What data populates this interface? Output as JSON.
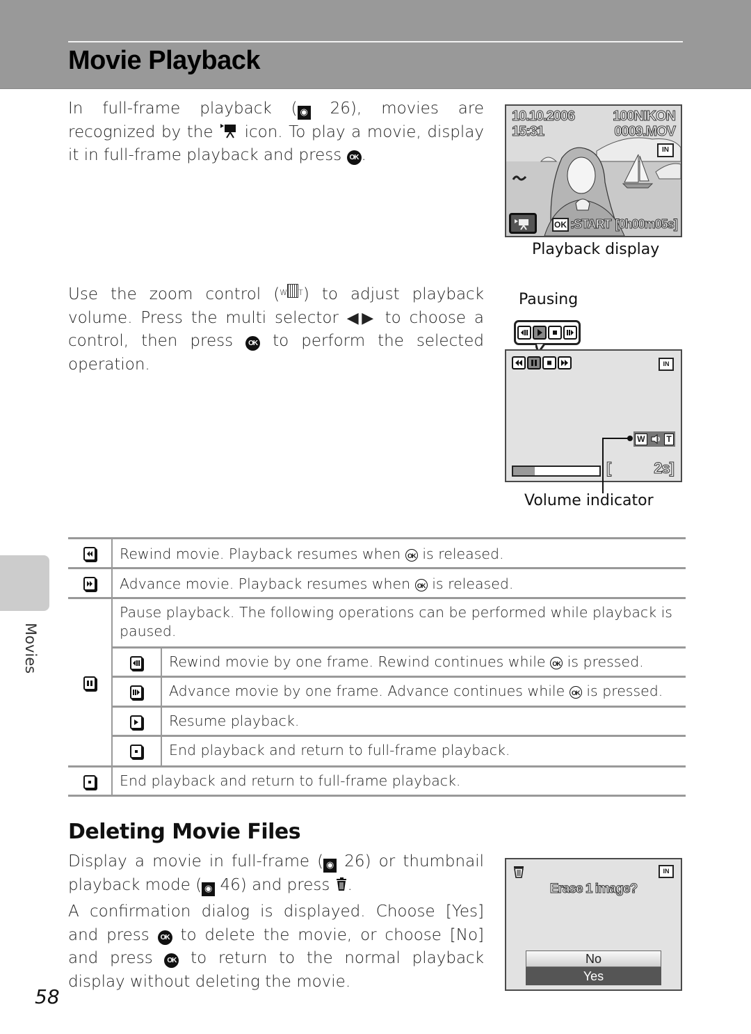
{
  "header": {
    "title": "Movie Playback"
  },
  "intro": {
    "p1_a": "In full-frame playback (",
    "p1_ref": "26",
    "p1_b": "), movies are recognized by the",
    "p1_c": "icon. To play a movie, display it in full-frame playback and press",
    "p1_end": ".",
    "p2_a": "Use the zoom control (",
    "p2_b": ") to adjust playback volume. Press the multi selector",
    "p2_c": "to choose a control, then press",
    "p2_d": "to perform the selected operation."
  },
  "icons": {
    "ok_button": "OK",
    "ref_icon": "reference-icon",
    "movie_icon": "movie-camera-icon",
    "zoom_w": "W",
    "zoom_t": "T",
    "multi_selector": "◀▶",
    "trash_icon": "delete-icon"
  },
  "playback_display": {
    "date": "10.10.2006",
    "time": "15:31",
    "folder": "100NIKON",
    "file": "0009.MOV",
    "memory": "IN",
    "ok_label": "OK",
    "start_label": ":START",
    "duration": "[0h00m05s]",
    "caption": "Playback display"
  },
  "pausing_display": {
    "label": "Pausing",
    "memory": "IN",
    "vol_w": "W",
    "vol_t": "T",
    "progress_fraction": 0.25,
    "time_open": "[",
    "time_remaining": "2s]",
    "caption": "Volume indicator"
  },
  "table": {
    "rows": [
      {
        "icon": "rewind-icon",
        "text": "Rewind movie. Playback resumes when",
        "text_end": "is released."
      },
      {
        "icon": "fast-forward-icon",
        "text": "Advance movie. Playback resumes when",
        "text_end": "is released."
      },
      {
        "icon": "pause-icon",
        "text": "Pause playback. The following operations can be performed while playback is paused.",
        "sub": [
          {
            "icon": "frame-rewind-icon",
            "text": "Rewind movie by one frame. Rewind continues while",
            "text_end": "is pressed."
          },
          {
            "icon": "frame-advance-icon",
            "text": "Advance movie by one frame. Advance continues while",
            "text_end": "is pressed."
          },
          {
            "icon": "resume-icon",
            "text": "Resume playback."
          },
          {
            "icon": "stop-icon",
            "text": "End playback and return to full-frame playback."
          }
        ]
      },
      {
        "icon": "stop-icon",
        "text": "End playback and return to full-frame playback."
      }
    ]
  },
  "sidebar": {
    "section_label": "Movies"
  },
  "deleting": {
    "title": "Deleting Movie Files",
    "p1_a": "Display a movie in full-frame (",
    "p1_ref1": "26",
    "p1_b": ") or thumbnail playback mode (",
    "p1_ref2": "46",
    "p1_c": ") and press",
    "p1_end": ".",
    "p2_a": "A confirmation dialog is displayed. Choose [Yes] and press",
    "p2_b": "to delete the movie, or choose [No] and press",
    "p2_c": "to return to the normal playback display without deleting the movie."
  },
  "erase_dialog": {
    "memory": "IN",
    "question": "Erase 1 image?",
    "options": [
      "No",
      "Yes"
    ],
    "selected": "Yes"
  },
  "footer": {
    "page_number": "58"
  },
  "colors": {
    "header_bg": "#999999",
    "screen_bg": "#e2e2e2",
    "selected_option": "#555555",
    "rule": "#999999"
  }
}
